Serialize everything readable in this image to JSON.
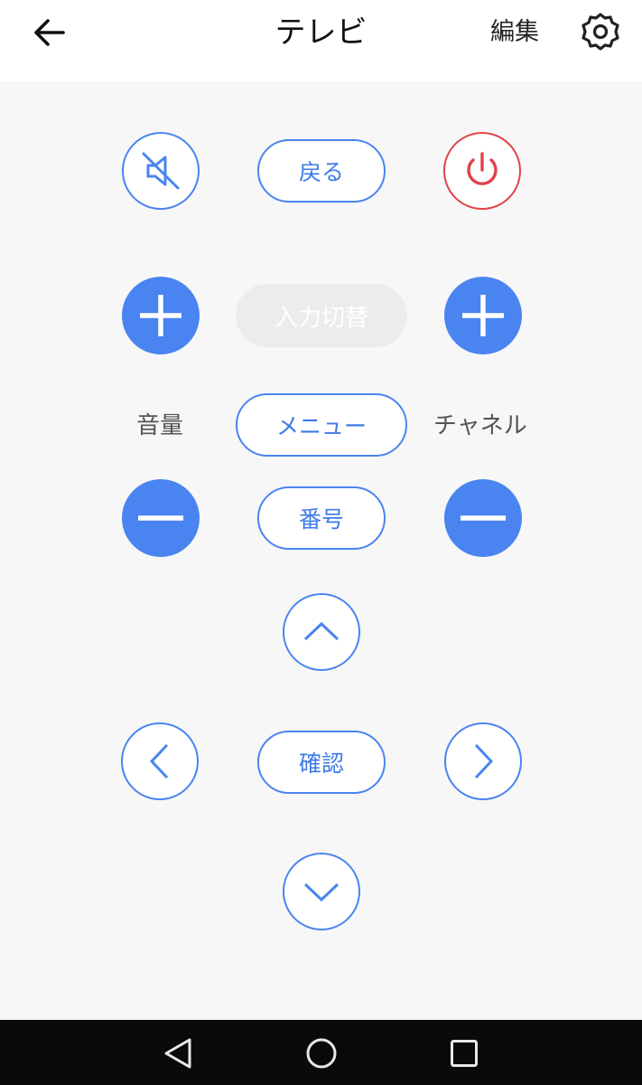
{
  "header": {
    "title": "テレビ",
    "edit_label": "編集",
    "back_icon": "arrow-left-icon",
    "settings_icon": "gear-icon"
  },
  "remote": {
    "mute_icon": "mute-icon",
    "back_label": "戻る",
    "power_icon": "power-icon",
    "input_label": "入力切替",
    "volume_label": "音量",
    "menu_label": "メニュー",
    "channel_label": "チャネル",
    "number_label": "番号",
    "ok_label": "確認",
    "volume_up_icon": "plus-icon",
    "volume_down_icon": "minus-icon",
    "channel_up_icon": "plus-icon",
    "channel_down_icon": "minus-icon",
    "up_icon": "chevron-up-icon",
    "down_icon": "chevron-down-icon",
    "left_icon": "chevron-left-icon",
    "right_icon": "chevron-right-icon"
  },
  "navbar": {
    "back_icon": "nav-back-icon",
    "home_icon": "nav-home-icon",
    "recents_icon": "nav-recents-icon"
  },
  "colors": {
    "accent": "#4a84f0",
    "power": "#e0424a",
    "background": "#f7f7f7"
  }
}
